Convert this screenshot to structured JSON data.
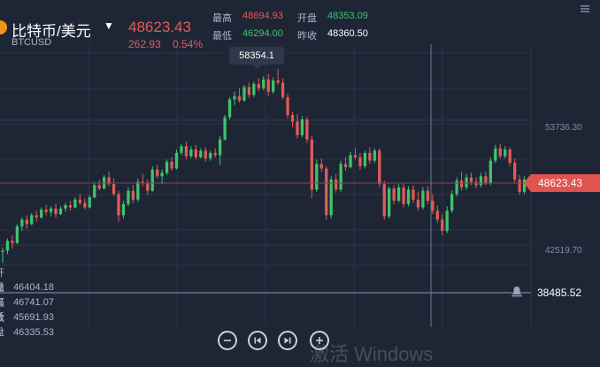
{
  "header": {
    "pair": "比特币/美元",
    "symbol": "BTCUSD",
    "price": "48623.43",
    "change": "262.93",
    "change_pct": "0.54%",
    "high_label": "最高",
    "high_value": "48694.93",
    "open_label": "开盘",
    "open_value": "48353.09",
    "low_label": "最低",
    "low_value": "46294.00",
    "prev_label": "昨收",
    "prev_value": "48360.50"
  },
  "tooltip": "58354.1",
  "current_price_tag": "48623.43",
  "alert_price": "38485.52",
  "ohlc_panel": [
    {
      "label": "开盘",
      "value": "46404.18"
    },
    {
      "label": "最高",
      "value": "46741.07"
    },
    {
      "label": "最低",
      "value": "45691.93"
    },
    {
      "label": "收盘",
      "value": "46335.53"
    }
  ],
  "watermark": "激活 Windows",
  "colors": {
    "up": "#3fc46a",
    "down": "#e15b57",
    "background": "#1e2636",
    "grid": "#2a3345"
  },
  "icons": [
    "coin-icon",
    "caret-down-icon",
    "menu-icon",
    "alert-bell-icon",
    "zoom-out-icon",
    "step-back-icon",
    "step-forward-icon",
    "zoom-in-icon"
  ],
  "chart_data": {
    "type": "candlestick",
    "y_ticks": [
      53736.3,
      42519.7
    ],
    "y_tick_labels": [
      "53736.30",
      "42519.70"
    ],
    "ylim": [
      38000,
      60000
    ],
    "grid": true,
    "current_price": 48623.43,
    "alert_level": 38485.52,
    "peak_high": 58354.1,
    "candles": [
      [
        41900,
        42300,
        40900,
        42000
      ],
      [
        42000,
        43100,
        41700,
        42900
      ],
      [
        42900,
        43400,
        42200,
        42700
      ],
      [
        42700,
        44400,
        42600,
        44200
      ],
      [
        44200,
        45000,
        43800,
        44800
      ],
      [
        44800,
        45200,
        44000,
        44400
      ],
      [
        44400,
        45400,
        44300,
        45200
      ],
      [
        45200,
        45600,
        44600,
        45000
      ],
      [
        45000,
        45900,
        44900,
        45700
      ],
      [
        45700,
        46100,
        45200,
        45500
      ],
      [
        45500,
        46000,
        45100,
        45800
      ],
      [
        45800,
        46200,
        45000,
        45300
      ],
      [
        45300,
        46000,
        45200,
        45800
      ],
      [
        45800,
        46300,
        45500,
        46100
      ],
      [
        46100,
        46500,
        45600,
        45900
      ],
      [
        45900,
        46800,
        45800,
        46600
      ],
      [
        46600,
        47100,
        46100,
        46300
      ],
      [
        46300,
        46700,
        45700,
        45900
      ],
      [
        45900,
        47000,
        45800,
        46800
      ],
      [
        46800,
        48200,
        46700,
        47900
      ],
      [
        47900,
        48400,
        47400,
        47600
      ],
      [
        47600,
        48800,
        47500,
        48600
      ],
      [
        48600,
        49100,
        47800,
        48000
      ],
      [
        48000,
        48500,
        46900,
        47100
      ],
      [
        47100,
        47400,
        44600,
        45200
      ],
      [
        45200,
        46500,
        44900,
        46200
      ],
      [
        46200,
        47700,
        46000,
        47400
      ],
      [
        47400,
        47900,
        46300,
        46600
      ],
      [
        46600,
        48500,
        46400,
        48200
      ],
      [
        48200,
        48900,
        47800,
        48100
      ],
      [
        48100,
        48400,
        47000,
        47400
      ],
      [
        47400,
        49600,
        47300,
        49300
      ],
      [
        49300,
        49700,
        48500,
        48700
      ],
      [
        48700,
        49300,
        48000,
        49000
      ],
      [
        49000,
        50200,
        48800,
        50000
      ],
      [
        50000,
        50400,
        49200,
        49400
      ],
      [
        49400,
        51100,
        49300,
        50800
      ],
      [
        50800,
        51600,
        50600,
        51400
      ],
      [
        51400,
        51800,
        50200,
        50500
      ],
      [
        50500,
        51400,
        50300,
        51100
      ],
      [
        51100,
        51500,
        50200,
        50400
      ],
      [
        50400,
        51200,
        50300,
        51000
      ],
      [
        51000,
        51300,
        50000,
        50300
      ],
      [
        50300,
        51000,
        50100,
        50800
      ],
      [
        50800,
        51200,
        50400,
        50600
      ],
      [
        50600,
        52300,
        49700,
        52000
      ],
      [
        52000,
        54200,
        51900,
        54000
      ],
      [
        54000,
        55800,
        53800,
        55600
      ],
      [
        55600,
        56300,
        55100,
        55900
      ],
      [
        55900,
        56600,
        55300,
        55500
      ],
      [
        55500,
        56900,
        55400,
        56700
      ],
      [
        56700,
        57100,
        55700,
        56000
      ],
      [
        56000,
        57200,
        55800,
        57000
      ],
      [
        57000,
        57500,
        56300,
        56600
      ],
      [
        56600,
        57700,
        56400,
        57400
      ],
      [
        57400,
        57900,
        55900,
        56300
      ],
      [
        56300,
        57600,
        56100,
        57300
      ],
      [
        57300,
        58354,
        56900,
        57100
      ],
      [
        57100,
        57500,
        55600,
        55800
      ],
      [
        55800,
        56100,
        53900,
        54200
      ],
      [
        54200,
        54500,
        53100,
        53600
      ],
      [
        53600,
        54300,
        52100,
        52400
      ],
      [
        52400,
        54100,
        52200,
        53800
      ],
      [
        53800,
        54000,
        51700,
        52000
      ],
      [
        52000,
        52300,
        46700,
        47500
      ],
      [
        47500,
        50200,
        47300,
        49800
      ],
      [
        49800,
        50300,
        49100,
        49400
      ],
      [
        49400,
        49600,
        44800,
        45200
      ],
      [
        45200,
        48700,
        44900,
        48400
      ],
      [
        48400,
        48900,
        47200,
        47500
      ],
      [
        47500,
        50100,
        47300,
        49800
      ],
      [
        49800,
        50400,
        49200,
        49500
      ],
      [
        49500,
        50900,
        49400,
        50600
      ],
      [
        50600,
        51200,
        50200,
        50400
      ],
      [
        50400,
        50800,
        49300,
        49600
      ],
      [
        49600,
        51000,
        49400,
        50800
      ],
      [
        50800,
        51300,
        49800,
        50100
      ],
      [
        50100,
        51200,
        49900,
        51000
      ],
      [
        51000,
        51200,
        47700,
        48000
      ],
      [
        48000,
        48300,
        44800,
        45100
      ],
      [
        45100,
        47800,
        44900,
        47600
      ],
      [
        47600,
        47900,
        46200,
        46500
      ],
      [
        46500,
        48000,
        46300,
        47700
      ],
      [
        47700,
        48100,
        45900,
        46200
      ],
      [
        46200,
        47800,
        46000,
        47500
      ],
      [
        47500,
        47900,
        46300,
        46600
      ],
      [
        46600,
        47300,
        45600,
        45900
      ],
      [
        45900,
        47700,
        45700,
        47400
      ],
      [
        47400,
        47800,
        46200,
        46500
      ],
      [
        46500,
        47100,
        45300,
        45600
      ],
      [
        45600,
        46100,
        44500,
        44800
      ],
      [
        44800,
        45300,
        43400,
        43800
      ],
      [
        43800,
        46000,
        43600,
        45600
      ],
      [
        45600,
        47400,
        45400,
        47100
      ],
      [
        47100,
        48600,
        46900,
        48300
      ],
      [
        48300,
        49100,
        47400,
        47700
      ],
      [
        47700,
        48900,
        47500,
        48600
      ],
      [
        48600,
        49000,
        47900,
        48200
      ],
      [
        48200,
        48600,
        47600,
        47900
      ],
      [
        47900,
        49000,
        47700,
        48700
      ],
      [
        48700,
        49100,
        47900,
        48100
      ],
      [
        48100,
        50400,
        47900,
        50100
      ],
      [
        50100,
        51500,
        49900,
        51200
      ],
      [
        51200,
        51600,
        50300,
        50500
      ],
      [
        50500,
        51400,
        50300,
        51100
      ],
      [
        51100,
        51300,
        49600,
        49900
      ],
      [
        49900,
        50300,
        48100,
        48400
      ],
      [
        48400,
        48800,
        47000,
        47300
      ],
      [
        47300,
        48700,
        47100,
        48400
      ],
      [
        48400,
        48700,
        47800,
        48623
      ]
    ]
  }
}
